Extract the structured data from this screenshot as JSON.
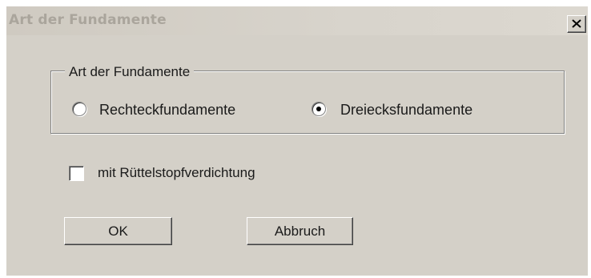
{
  "window": {
    "title": "Art der Fundamente",
    "close_icon": "close-icon"
  },
  "group": {
    "legend": "Art der Fundamente",
    "options": [
      {
        "label": "Rechteckfundamente",
        "selected": false
      },
      {
        "label": "Dreiecksfundamente",
        "selected": true
      }
    ]
  },
  "checkbox": {
    "label": "mit Rüttelstopfverdichtung",
    "checked": false
  },
  "buttons": {
    "ok_label": "OK",
    "cancel_label": "Abbruch"
  }
}
